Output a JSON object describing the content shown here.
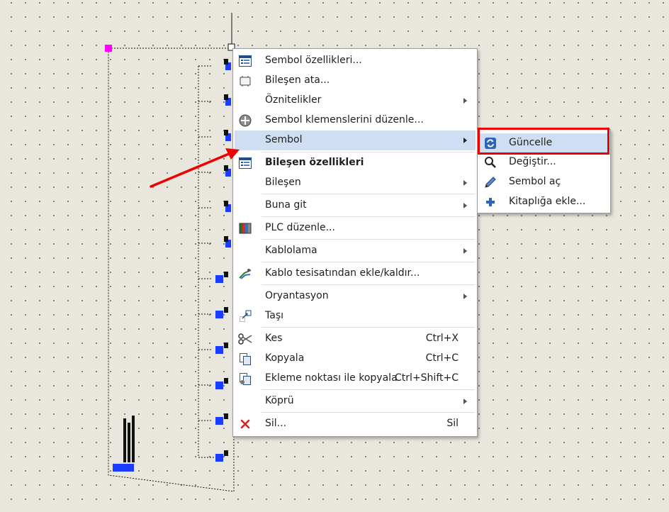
{
  "context_menu": {
    "items": [
      {
        "label": "Sembol özellikleri...",
        "icon": "properties-list-icon",
        "submenu": false,
        "bold": false
      },
      {
        "label": "Bileşen ata...",
        "icon": "component-box-icon",
        "submenu": false,
        "bold": false
      },
      {
        "label": "Öznitelikler",
        "icon": "",
        "submenu": true,
        "bold": false
      },
      {
        "label": "Sembol klemenslerini düzenle...",
        "icon": "terminal-plus-icon",
        "submenu": false,
        "bold": false
      },
      {
        "label": "Sembol",
        "icon": "",
        "submenu": true,
        "bold": false,
        "highlighted": true
      },
      {
        "label": "Bileşen özellikleri",
        "icon": "properties-list-icon",
        "submenu": false,
        "bold": true
      },
      {
        "label": "Bileşen",
        "icon": "",
        "submenu": true,
        "bold": false
      },
      {
        "label": "Buna git",
        "icon": "",
        "submenu": true,
        "bold": false
      },
      {
        "label": "PLC düzenle...",
        "icon": "plc-modules-icon",
        "submenu": false,
        "bold": false
      },
      {
        "label": "Kablolama",
        "icon": "",
        "submenu": true,
        "bold": false
      },
      {
        "label": "Kablo tesisatından ekle/kaldır...",
        "icon": "harness-icon",
        "submenu": false,
        "bold": false
      },
      {
        "label": "Oryantasyon",
        "icon": "",
        "submenu": true,
        "bold": false
      },
      {
        "label": "Taşı",
        "icon": "move-icon",
        "submenu": false,
        "bold": false
      },
      {
        "label": "Kes",
        "icon": "scissors-icon",
        "shortcut": "Ctrl+X",
        "submenu": false,
        "bold": false
      },
      {
        "label": "Kopyala",
        "icon": "copy-icon",
        "shortcut": "Ctrl+C",
        "submenu": false,
        "bold": false
      },
      {
        "label": "Ekleme noktası ile kopyala",
        "icon": "copy-insert-point-icon",
        "shortcut": "Ctrl+Shift+C",
        "submenu": false,
        "bold": false
      },
      {
        "label": "Köprü",
        "icon": "",
        "submenu": true,
        "bold": false
      },
      {
        "label": "Sil...",
        "icon": "delete-x-icon",
        "shortcut": "Sil",
        "submenu": false,
        "bold": false
      }
    ]
  },
  "symbol_submenu": {
    "items": [
      {
        "label": "Güncelle",
        "icon": "refresh-icon",
        "highlighted": true
      },
      {
        "label": "Değiştir...",
        "icon": "magnifier-icon"
      },
      {
        "label": "Sembol aç",
        "icon": "pencil-icon"
      },
      {
        "label": "Kitaplığa ekle...",
        "icon": "plus-icon"
      }
    ]
  },
  "colors": {
    "accent_highlight": "#cfdff3",
    "annotation_red": "#ee0000",
    "grip_magenta": "#ff00ff",
    "terminal_blue": "#1a3cff",
    "canvas_background": "#e9e7dd"
  }
}
